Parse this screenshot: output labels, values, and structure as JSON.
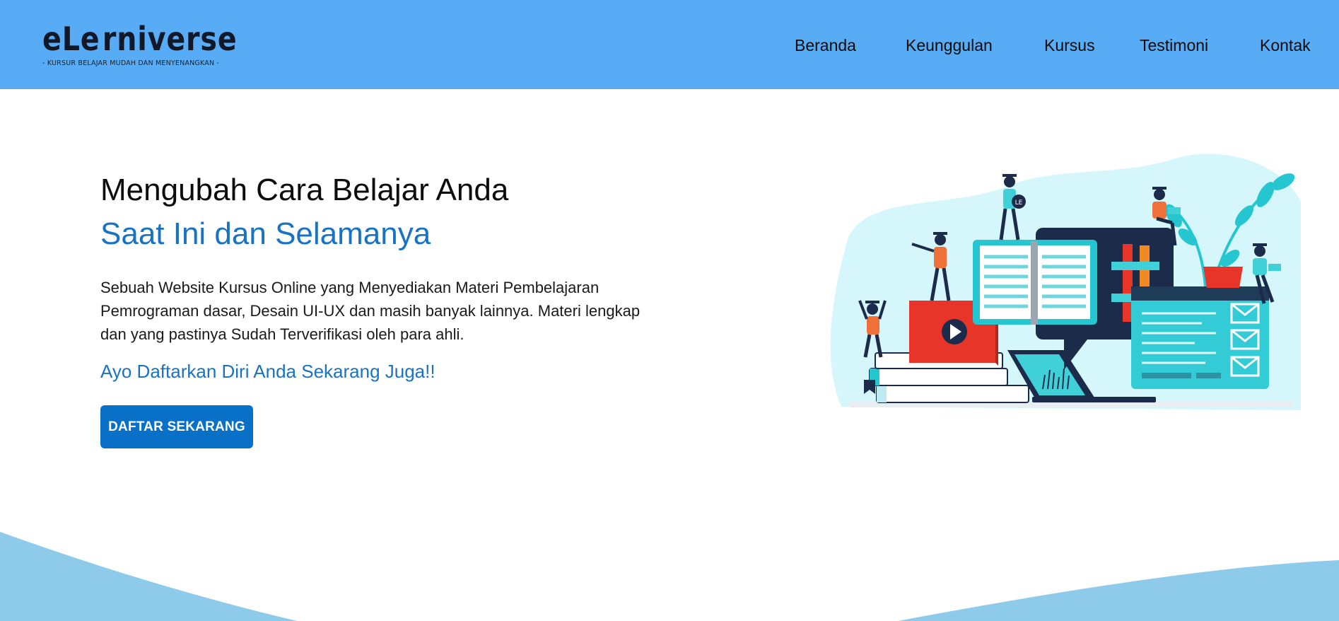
{
  "brand": {
    "logo_text_left": "eLe",
    "logo_text_right": "rniverse",
    "tagline": "- KURSUR BELAJAR MUDAH DAN MENYENANGKAN -"
  },
  "nav": {
    "items": [
      {
        "label": "Beranda"
      },
      {
        "label": "Keunggulan"
      },
      {
        "label": "Kursus"
      },
      {
        "label": "Testimoni"
      },
      {
        "label": "Kontak"
      }
    ]
  },
  "hero": {
    "title_line1": "Mengubah Cara Belajar Anda",
    "title_line2": "Saat Ini dan Selamanya",
    "description": "Sebuah Website Kursus Online yang Menyediakan Materi Pembelajaran Pemrograman dasar, Desain UI-UX dan masih banyak lainnya. Materi lengkap dan yang pastinya Sudah Terverifikasi oleh para ahli.",
    "cta_text": "Ayo Daftarkan Diri Anda Sekarang Juga!!",
    "cta_button": "DAFTAR SEKARANG",
    "illustration_badge": "LE"
  },
  "colors": {
    "header_bg": "#58acf6",
    "accent_blue": "#1a73c2",
    "button_bg": "#0870c6",
    "wave": "#8ecbea",
    "teal": "#26c6d0",
    "red": "#e8352a",
    "navy": "#1c2b4a"
  },
  "icons": [
    "logo-triangle-icon",
    "play-icon",
    "mail-icon",
    "bookmark-icon"
  ]
}
